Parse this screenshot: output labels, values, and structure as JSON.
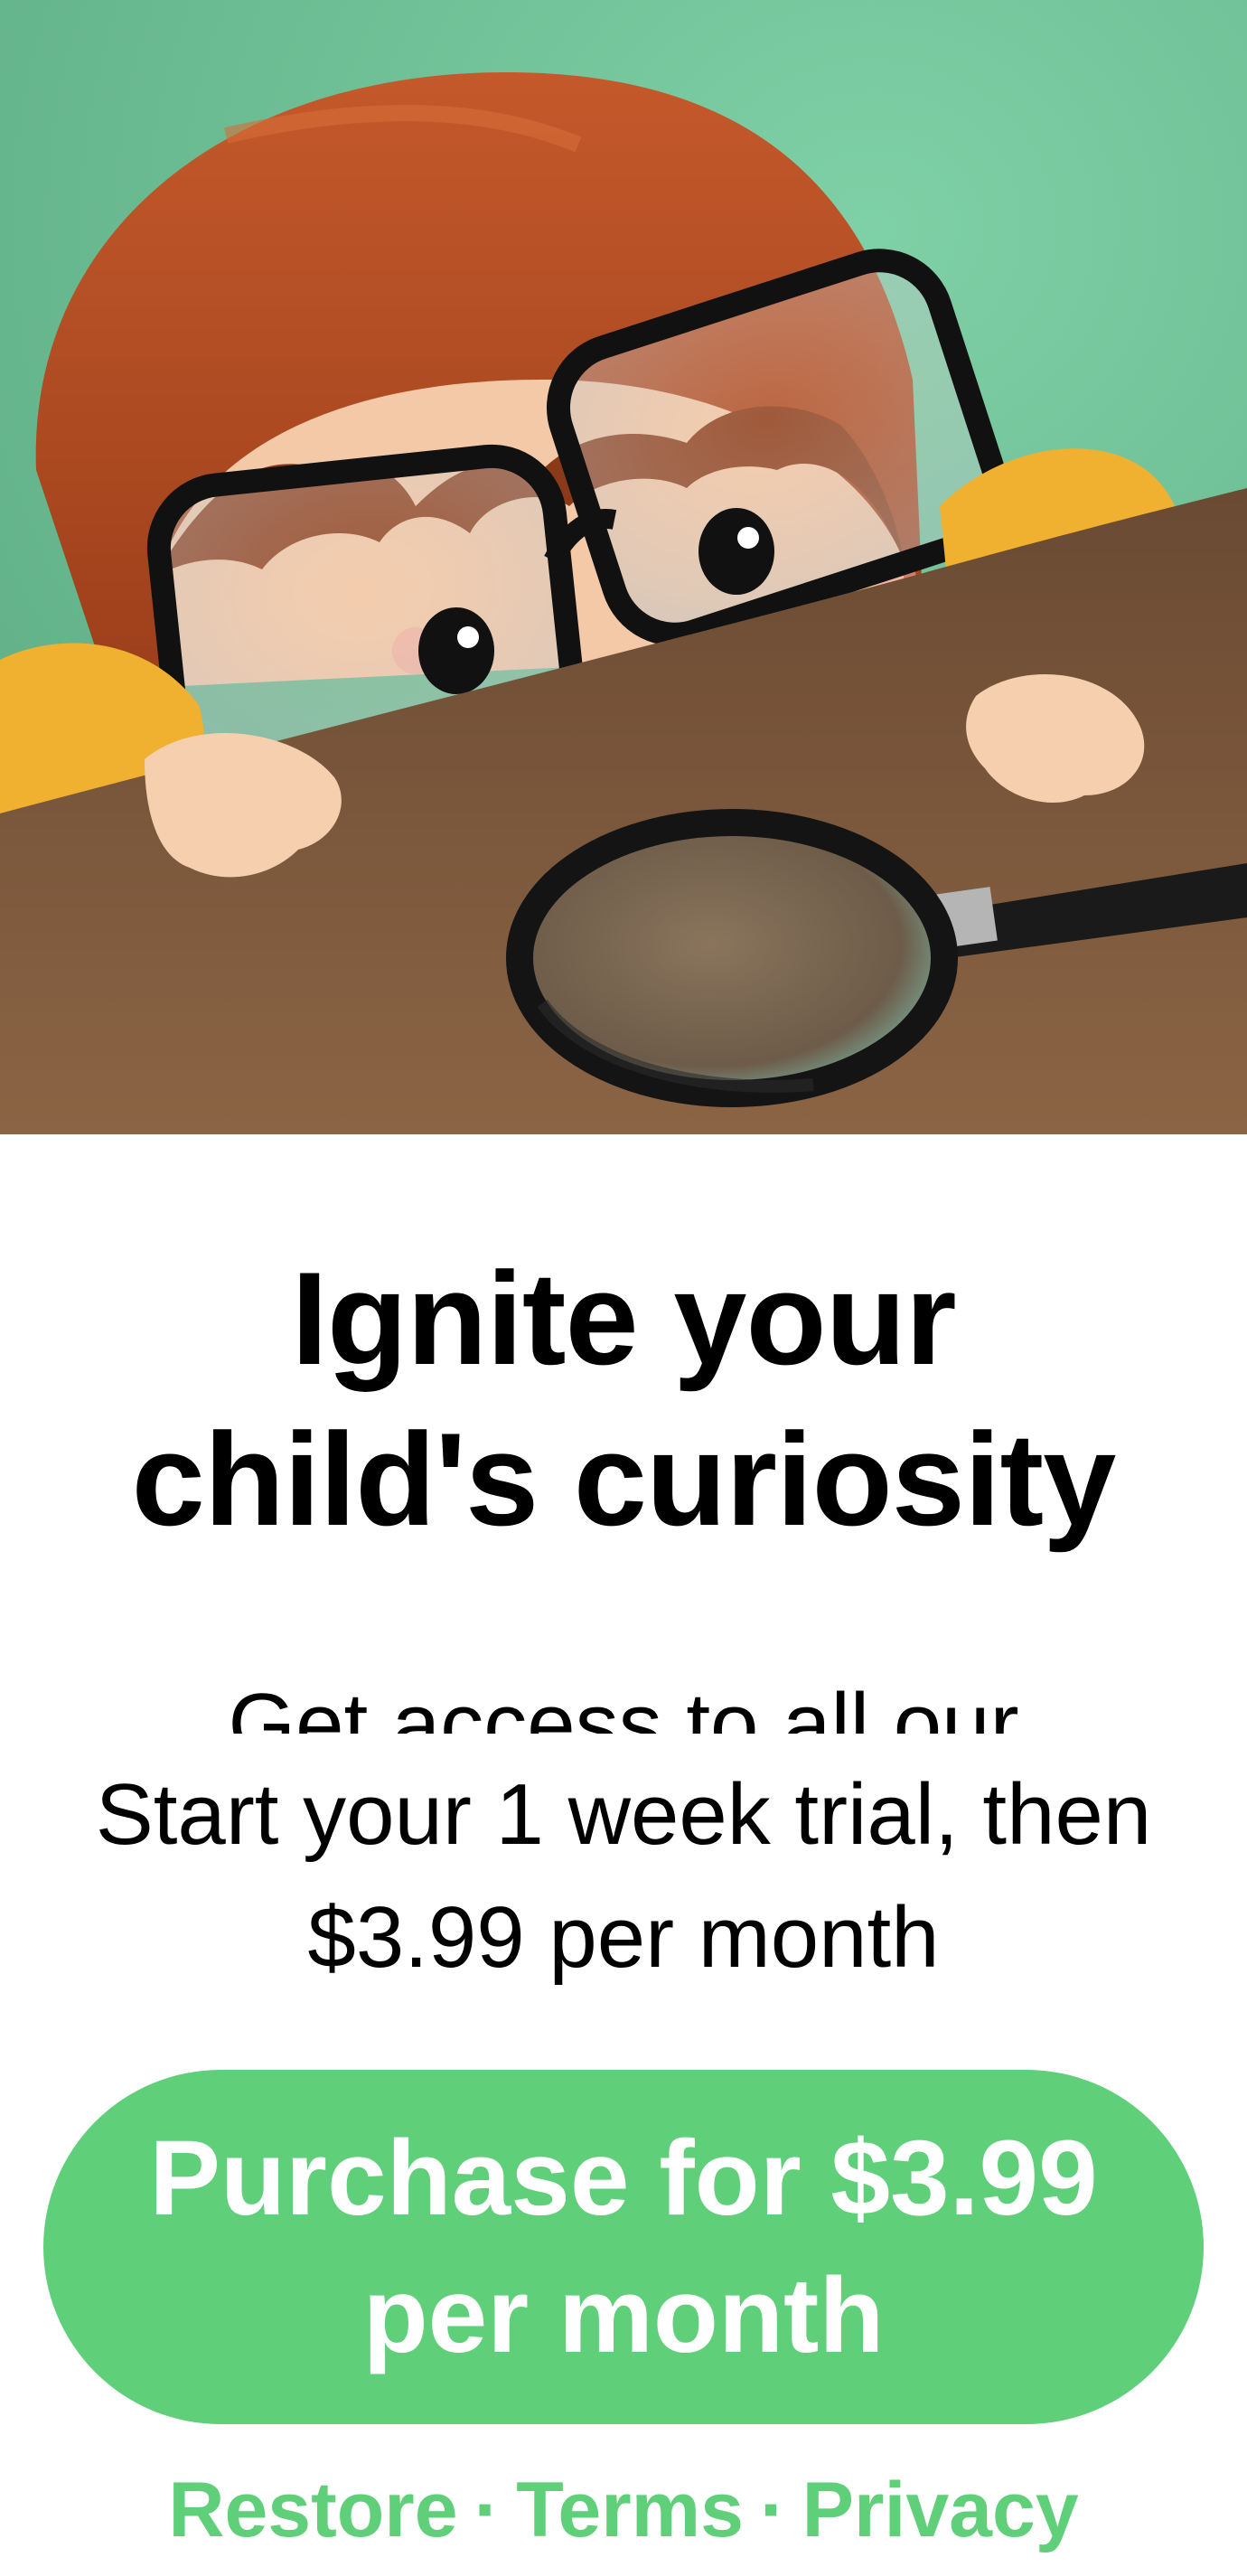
{
  "paywall": {
    "title_line1": "Ignite your",
    "title_line2": "child's curiosity",
    "subtitle_partial": "Get access to all our",
    "trial_line1": "Start your 1 week trial, then",
    "trial_line2": "$3.99 per month",
    "purchase_line1": "Purchase for $3.99",
    "purchase_line2": "per month"
  },
  "links": {
    "restore": "Restore",
    "terms": "Terms",
    "privacy": "Privacy",
    "separator": "·"
  },
  "colors": {
    "accent": "#5fcf79",
    "hero_background": "#6cbf95",
    "text": "#000000"
  },
  "hero": {
    "illustration": "child-with-glasses-and-magnifying-glass"
  }
}
